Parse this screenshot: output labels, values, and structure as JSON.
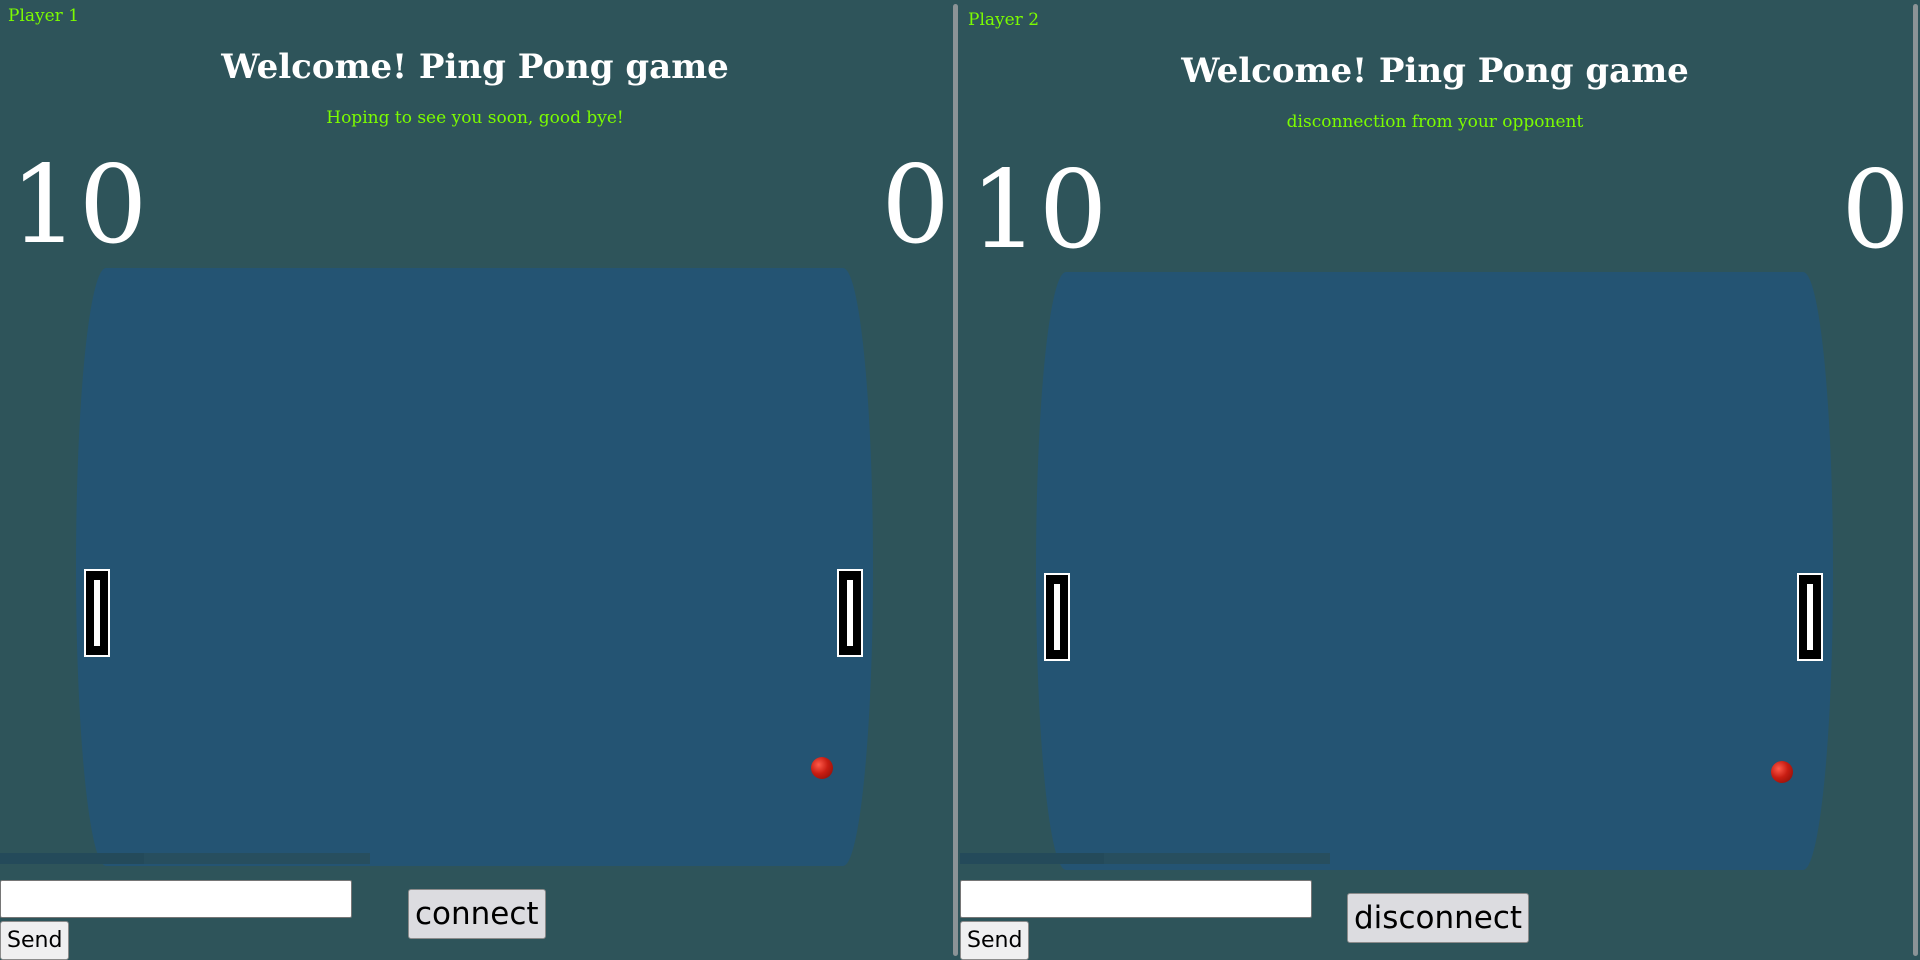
{
  "panes": {
    "left": {
      "player_label": "Player 1",
      "title": "Welcome! Ping Pong game",
      "status": "Hoping to see you soon, good bye!",
      "score_left": "10",
      "score_right": "0",
      "input_value": "",
      "send_label": "Send",
      "connection_button_label": "connect",
      "progress": 0.39
    },
    "right": {
      "player_label": "Player 2",
      "title": "Welcome! Ping Pong game",
      "status": "disconnection from your opponent",
      "score_left": "10",
      "score_right": "0",
      "input_value": "",
      "send_label": "Send",
      "connection_button_label": "disconnect",
      "progress": 0.39
    }
  },
  "colors": {
    "background": "#2e545a",
    "court": "#245473",
    "status_text": "#7cfc00",
    "title_text": "#ffffff",
    "ball": "#c81d12"
  }
}
